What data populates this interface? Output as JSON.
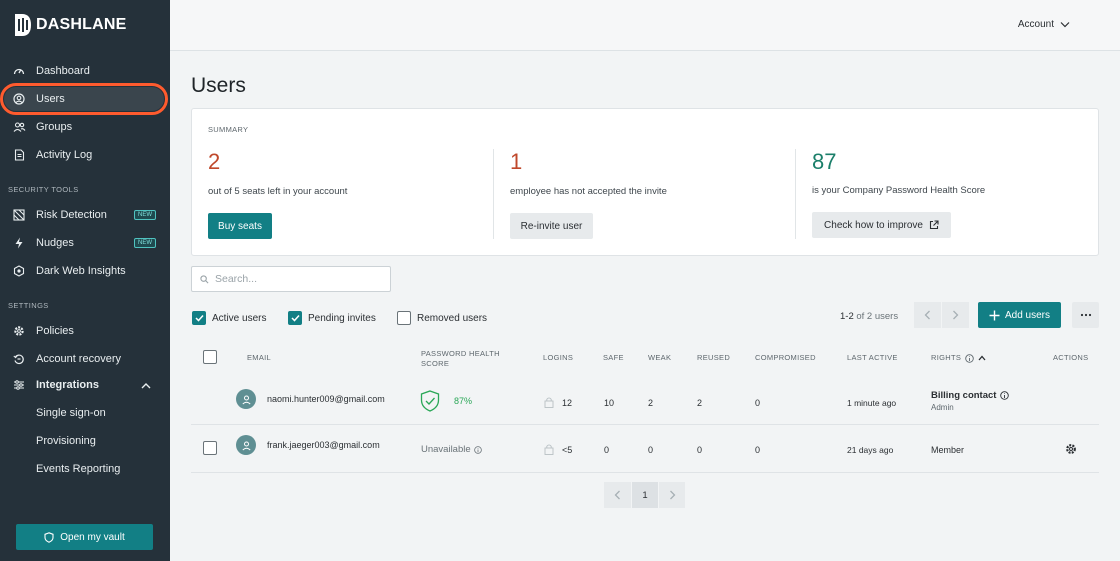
{
  "brand": {
    "name": "DASHLANE"
  },
  "sidebar": {
    "items": [
      {
        "label": "Dashboard",
        "icon": "gauge-icon"
      },
      {
        "label": "Users",
        "icon": "user-circle-icon",
        "active": true
      },
      {
        "label": "Groups",
        "icon": "users-icon"
      },
      {
        "label": "Activity Log",
        "icon": "document-icon"
      }
    ],
    "security_label": "SECURITY TOOLS",
    "security_items": [
      {
        "label": "Risk Detection",
        "badge": "NEW",
        "icon": "risk-icon"
      },
      {
        "label": "Nudges",
        "badge": "NEW",
        "icon": "bolt-icon"
      },
      {
        "label": "Dark Web Insights",
        "icon": "dark-web-icon"
      }
    ],
    "settings_label": "SETTINGS",
    "settings_items": [
      {
        "label": "Policies",
        "icon": "gear-icon"
      },
      {
        "label": "Account recovery",
        "icon": "recovery-icon"
      },
      {
        "label": "Integrations",
        "icon": "sliders-icon"
      }
    ],
    "integrations_sub": [
      "Single sign-on",
      "Provisioning",
      "Events Reporting"
    ],
    "vault_button": "Open my vault"
  },
  "header": {
    "account": "Account"
  },
  "page": {
    "title": "Users"
  },
  "summary": {
    "label": "SUMMARY",
    "seats": {
      "value": "2",
      "text": "out of 5 seats left in your account",
      "button": "Buy seats"
    },
    "invites": {
      "value": "1",
      "text": "employee has not accepted the invite",
      "button": "Re-invite user"
    },
    "health": {
      "value": "87",
      "text": "is your Company Password Health Score",
      "button": "Check how to improve"
    }
  },
  "search": {
    "placeholder": "Search..."
  },
  "filters": [
    {
      "label": "Active users",
      "checked": true
    },
    {
      "label": "Pending invites",
      "checked": true
    },
    {
      "label": "Removed users",
      "checked": false
    }
  ],
  "pager": {
    "range": "1-2",
    "total": "of 2 users",
    "page": "1"
  },
  "add_users": "Add users",
  "table": {
    "headers": {
      "email": "EMAIL",
      "health_1": "PASSWORD HEALTH",
      "health_2": "SCORE",
      "logins": "LOGINS",
      "safe": "SAFE",
      "weak": "WEAK",
      "reused": "REUSED",
      "compromised": "COMPROMISED",
      "last_active": "LAST ACTIVE",
      "rights": "RIGHTS",
      "actions": "ACTIONS"
    },
    "rows": [
      {
        "email": "naomi.hunter009@gmail.com",
        "health": "87%",
        "logins": "12",
        "safe": "10",
        "weak": "2",
        "reused": "2",
        "compromised": "0",
        "last_active": "1 minute ago",
        "rights": "Billing contact",
        "rights_sub": "Admin"
      },
      {
        "email": "frank.jaeger003@gmail.com",
        "health": "Unavailable",
        "logins": "<5",
        "safe": "0",
        "weak": "0",
        "reused": "0",
        "compromised": "0",
        "last_active": "21 days ago",
        "rights": "Member"
      }
    ]
  },
  "colors": {
    "accent": "#127f85",
    "sidebar": "#25313a",
    "alert": "#c0482b",
    "score": "#1b7f6a",
    "highlight": "#ff5b2e"
  }
}
